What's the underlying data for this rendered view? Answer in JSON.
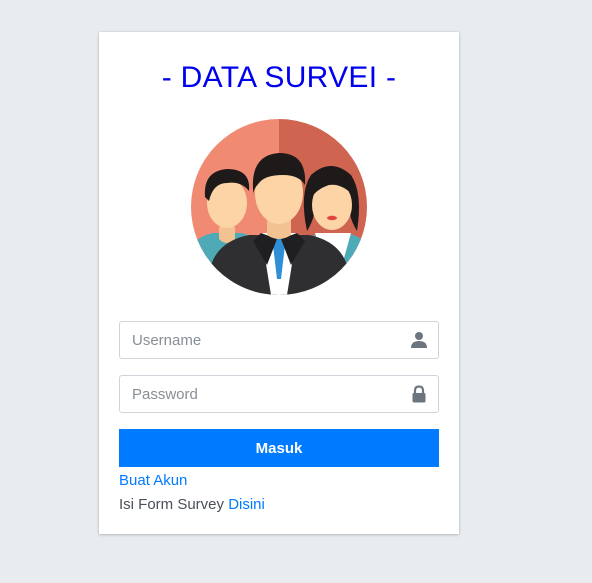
{
  "login": {
    "title": "- DATA SURVEI -",
    "username_placeholder": "Username",
    "password_placeholder": "Password",
    "submit_label": "Masuk",
    "create_account_link": "Buat Akun",
    "survey_text": "Isi Form Survey ",
    "survey_link": "Disini"
  },
  "icons": {
    "avatar": "team-avatar-icon",
    "username": "user-icon",
    "password": "lock-icon"
  },
  "colors": {
    "accent": "#007bff",
    "title": "#0000ee"
  }
}
